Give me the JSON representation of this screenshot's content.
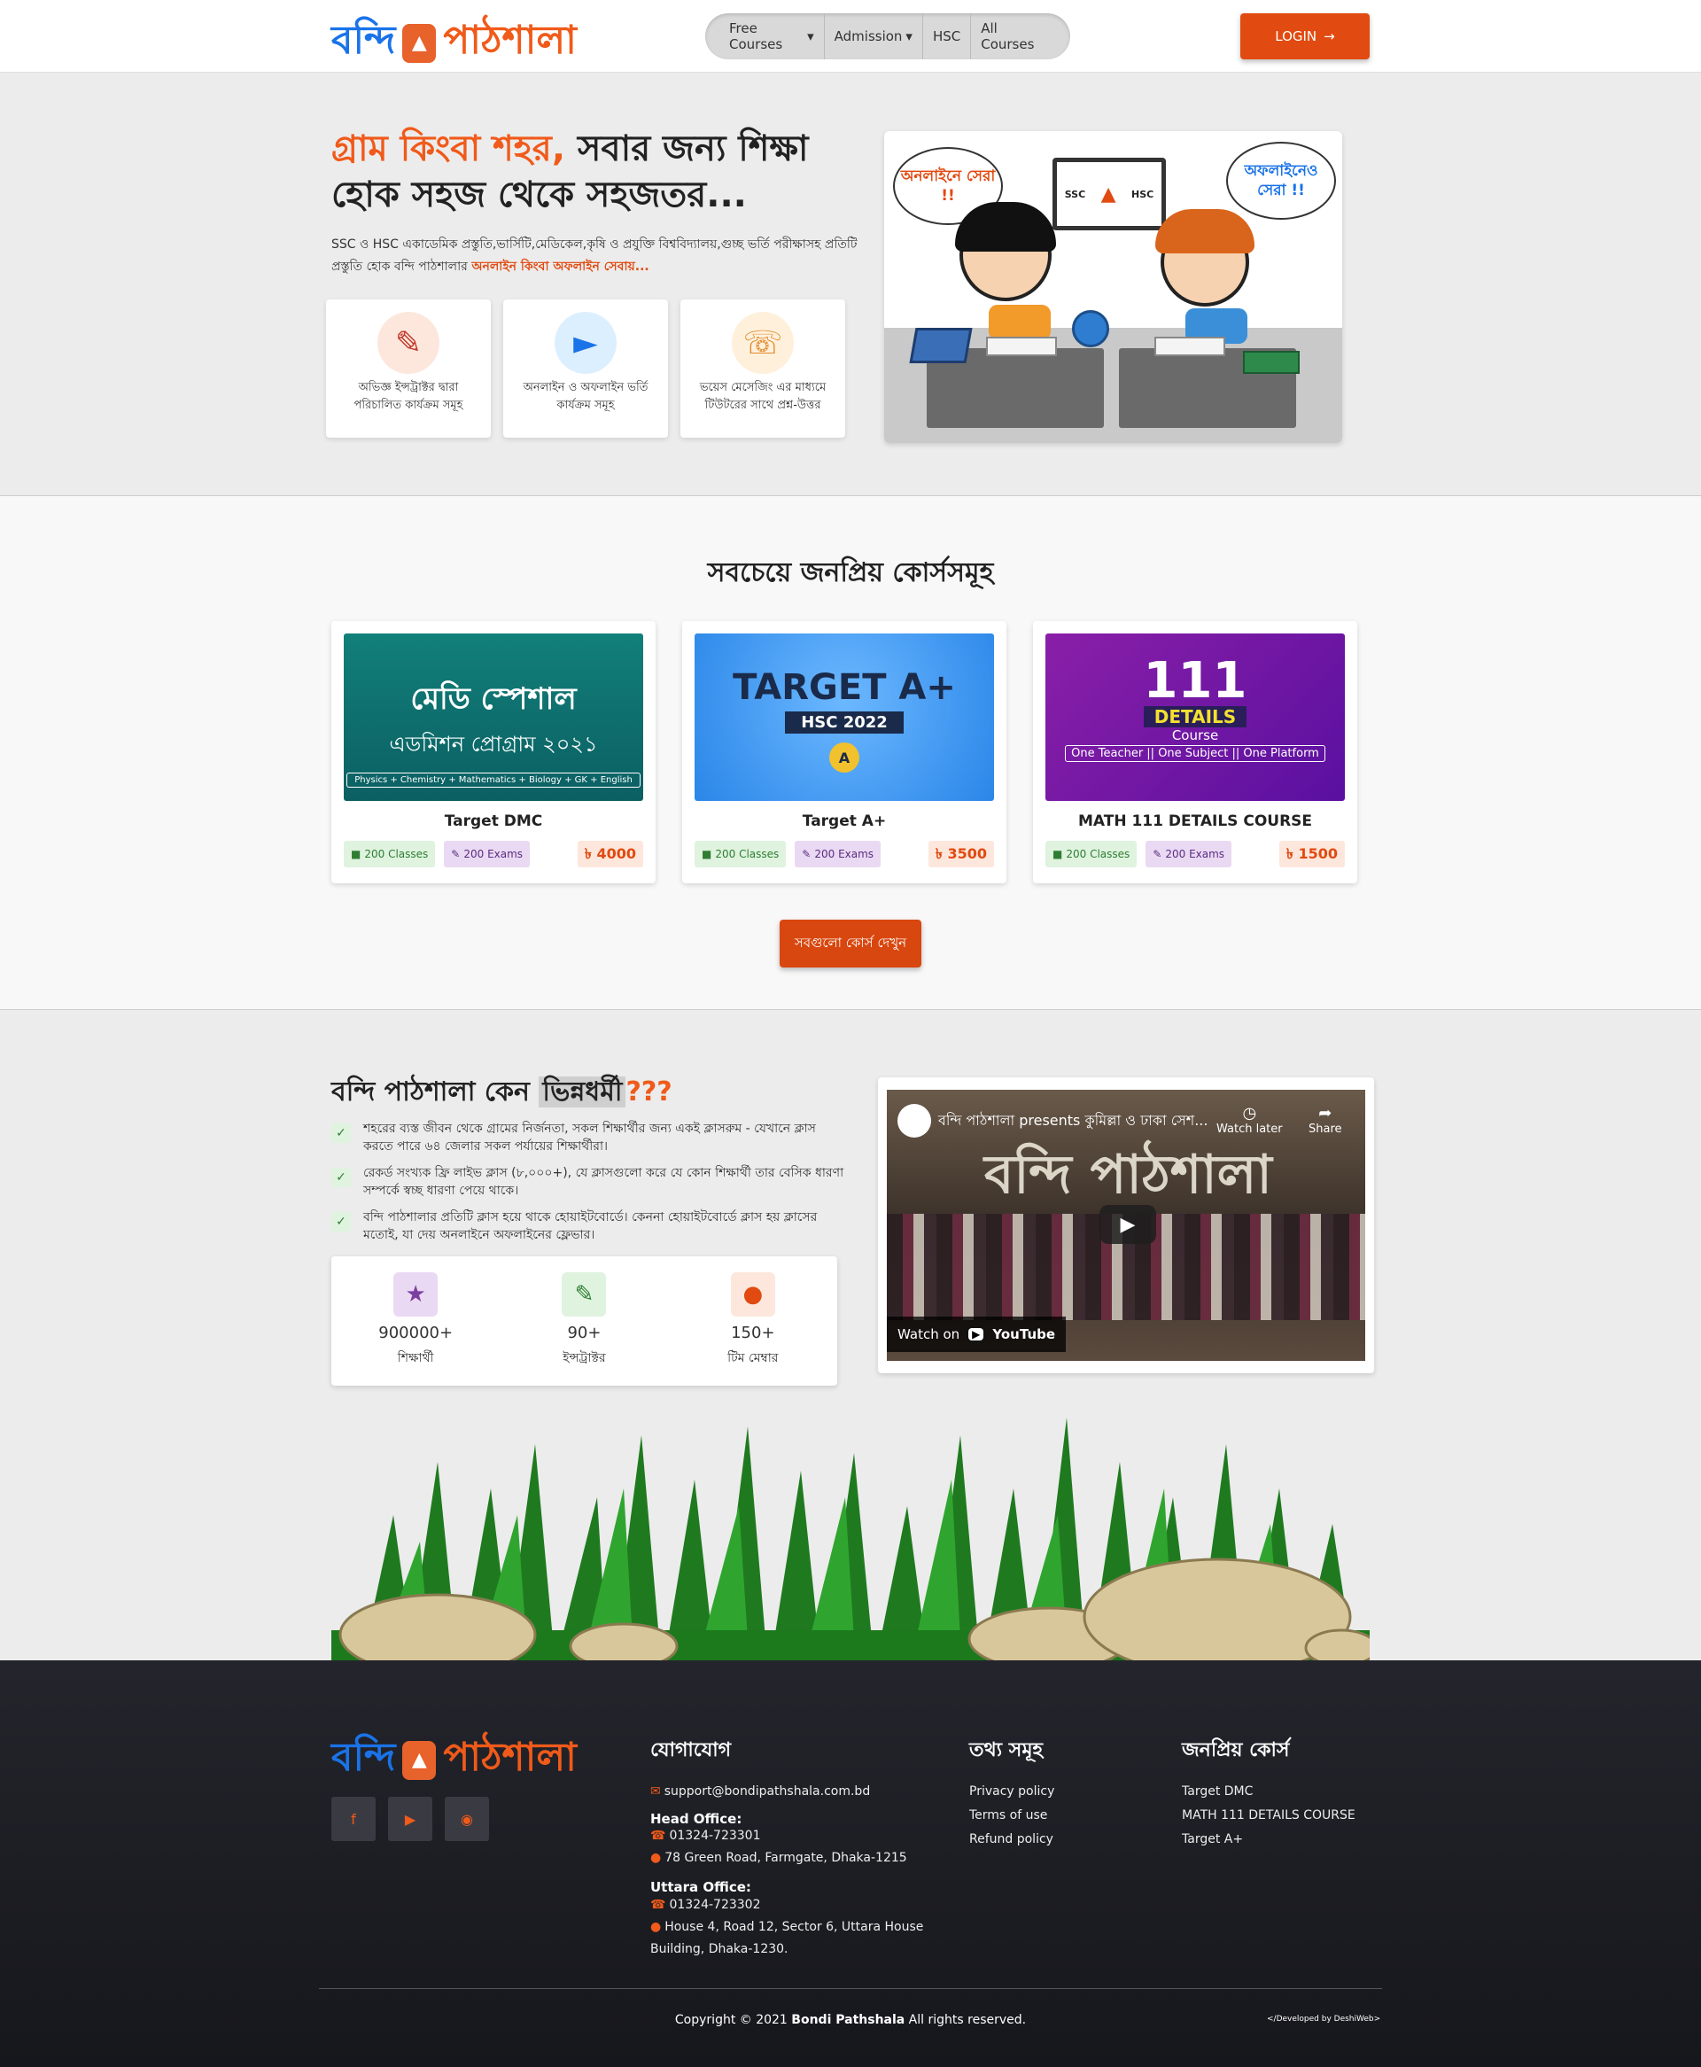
{
  "header": {
    "logo_part1": "বন্দি",
    "logo_part2": "পাঠশালা",
    "nav": [
      "Free Courses",
      "Admission",
      "HSC",
      "All Courses"
    ],
    "login": "LOGIN"
  },
  "hero": {
    "title_accent": "গ্রাম কিংবা শহর,",
    "title_rest": " সবার জন্য শিক্ষা হোক সহজ থেকে সহজতর...",
    "desc": "SSC ও HSC একাডেমিক প্রস্তুতি,ভার্সিটি,মেডিকেল,কৃষি ও প্রযুক্তি বিশ্ববিদ্যালয়,গুচ্ছ ভর্তি পরীক্ষাসহ প্রতিটি প্রস্তুতি হোক বন্দি পাঠশালার ",
    "desc_highlight": "অনলাইন কিংবা অফলাইন সেবায়...",
    "features": [
      {
        "icon": "teacher-icon",
        "text": "অভিজ্ঞ ইন্সট্রাক্টর দ্বারা পরিচালিত কার্যক্রম সমূহ"
      },
      {
        "icon": "online-learning-icon",
        "text": "অনলাইন ও অফলাইন ভর্তি কার্যক্রম সমূহ"
      },
      {
        "icon": "support-agent-icon",
        "text": "ভয়েস মেসেজিং এর মাধ্যমে টিউটরের সাথে প্রশ্ন-উত্তর"
      }
    ],
    "art": {
      "bubble_left": "অনলাইনে সেরা !!",
      "bubble_right": "অফলাইনেও সেরা !!",
      "tv_left": "SSC",
      "tv_right": "HSC"
    }
  },
  "courses": {
    "heading": "সবচেয়ে জনপ্রিয় কোর্সসমূহ",
    "items": [
      {
        "name": "Target DMC",
        "classes": "200 Classes",
        "exams": "200 Exams",
        "price": "৳ 4000",
        "thumb_title": "মেডি স্পেশাল",
        "thumb_sub": "এডমিশন প্রোগ্রাম ২০২১",
        "thumb_foot": "Physics + Chemistry + Mathematics + Biology + GK + English"
      },
      {
        "name": "Target A+",
        "classes": "200 Classes",
        "exams": "200 Exams",
        "price": "৳ 3500",
        "thumb_title": "TARGET A+",
        "thumb_sub": "HSC 2022",
        "thumb_foot": ""
      },
      {
        "name": "MATH 111 DETAILS COURSE",
        "classes": "200 Classes",
        "exams": "200 Exams",
        "price": "৳ 1500",
        "thumb_title": "111",
        "thumb_sub": "DETAILS",
        "thumb_sub2": "Course",
        "thumb_foot": "One Teacher || One Subject || One Platform"
      }
    ],
    "all_button": "সবগুলো কোর্স দেখুন"
  },
  "why": {
    "heading_pre": "বন্দি পাঠশালা কেন ",
    "heading_hl": "ভিন্নধর্মী",
    "heading_q": "???",
    "points": [
      "শহরের ব্যস্ত জীবন থেকে গ্রামের নির্জনতা, সকল শিক্ষার্থীর জন্য একই ক্লাসরুম - যেখানে ক্লাস করতে পারে ৬৪ জেলার সকল পর্যায়ের শিক্ষার্থীরা।",
      "রেকর্ড সংখ্যক ফ্রি লাইভ ক্লাস (৮,০০০+), যে ক্লাসগুলো করে যে কোন শিক্ষার্থী তার বেসিক ধারণা সম্পর্কে স্বচ্ছ ধারণা পেয়ে থাকে।",
      "বন্দি পাঠশালার প্রতিটি ক্লাস হয়ে থাকে হোয়াইটবোর্ডে। কেননা হোয়াইটবোর্ডে ক্লাস হয় ক্লাসের মতোই, যা দেয় অনলাইনে অফলাইনের ফ্লেভার।"
    ],
    "stats": [
      {
        "icon": "student-icon",
        "num": "900000+",
        "label": "শিক্ষার্থী",
        "color": "#7b3fa0",
        "bg": "#ead9f3"
      },
      {
        "icon": "instructor-icon",
        "num": "90+",
        "label": "ইন্সট্রাক্টর",
        "color": "#2e7d32",
        "bg": "#dff3df"
      },
      {
        "icon": "team-icon",
        "num": "150+",
        "label": "টিম মেম্বার",
        "color": "#e14a10",
        "bg": "#fde7dc"
      }
    ],
    "video": {
      "title": "বন্দি পাঠশালা presents কুমিল্লা ও ঢাকা সেশ...",
      "watch_later": "Watch later",
      "share": "Share",
      "watch_on": "Watch on",
      "youtube": "YouTube",
      "banner": "বন্দি পাঠশালা"
    }
  },
  "footer": {
    "logo_part1": "বন্দি",
    "logo_part2": "পাঠশালা",
    "contact_heading": "যোগাযোগ",
    "email": "support@bondipathshala.com.bd",
    "head_office": "Head Office:",
    "head_phone": "01324-723301",
    "head_address": "78 Green Road, Farmgate, Dhaka-1215",
    "uttara_office": "Uttara Office:",
    "uttara_phone": "01324-723302",
    "uttara_address_1": "House 4, Road 12, Sector 6, Uttara House",
    "uttara_address_2": "Building, Dhaka-1230.",
    "info_heading": "তথ্য সমূহ",
    "info_links": [
      "Privacy policy",
      "Terms of use",
      "Refund policy"
    ],
    "popular_heading": "জনপ্রিয় কোর্স",
    "popular_links": [
      "Target DMC",
      "MATH 111 DETAILS COURSE",
      "Target A+"
    ],
    "copy_pre": "Copyright © 2021 ",
    "copy_brand": "Bondi Pathshala",
    "copy_post": " All rights reserved.",
    "dev": "</Developed by DeshiWeb>"
  }
}
